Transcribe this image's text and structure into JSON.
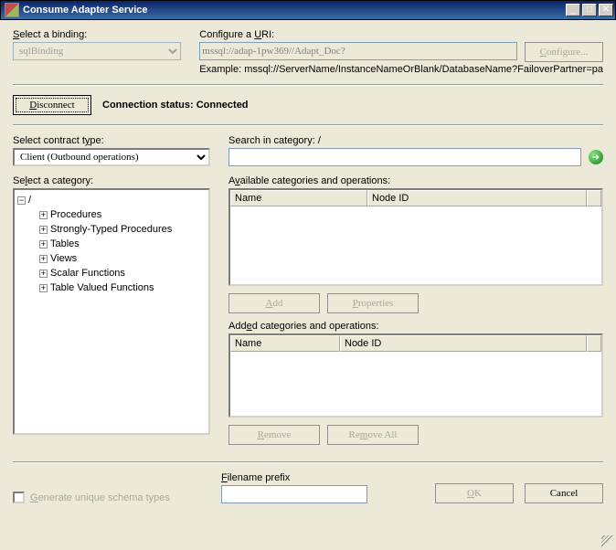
{
  "title": "Consume Adapter Service",
  "binding": {
    "label": "Select a binding:",
    "value": "sqlBinding"
  },
  "uri": {
    "label": "Configure a URI:",
    "value": "mssql://adap-1pw369//Adapt_Doc?",
    "configure_label": "Configure...",
    "example": "Example: mssql://ServerName/InstanceNameOrBlank/DatabaseName?FailoverPartner=pa"
  },
  "disconnect_label": "Disconnect",
  "connection_status_label": "Connection status:",
  "connection_status": "Connected",
  "contract_type": {
    "label": "Select contract type:",
    "value": "Client (Outbound operations)"
  },
  "search": {
    "label": "Search in category: /",
    "value": ""
  },
  "category_label": "Select a category:",
  "category_root": "/",
  "categories": [
    "Procedures",
    "Strongly-Typed Procedures",
    "Tables",
    "Views",
    "Scalar Functions",
    "Table Valued Functions"
  ],
  "available": {
    "label": "Available categories and operations:",
    "col_name": "Name",
    "col_nodeid": "Node ID",
    "add_label": "Add",
    "props_label": "Properties"
  },
  "added": {
    "label": "Added categories and operations:",
    "col_name": "Name",
    "col_nodeid": "Node ID",
    "remove_label": "Remove",
    "removeall_label": "Remove All"
  },
  "generate_unique_label": "Generate unique schema types",
  "filename_prefix_label": "Filename prefix",
  "filename_prefix_value": "",
  "ok_label": "OK",
  "cancel_label": "Cancel"
}
